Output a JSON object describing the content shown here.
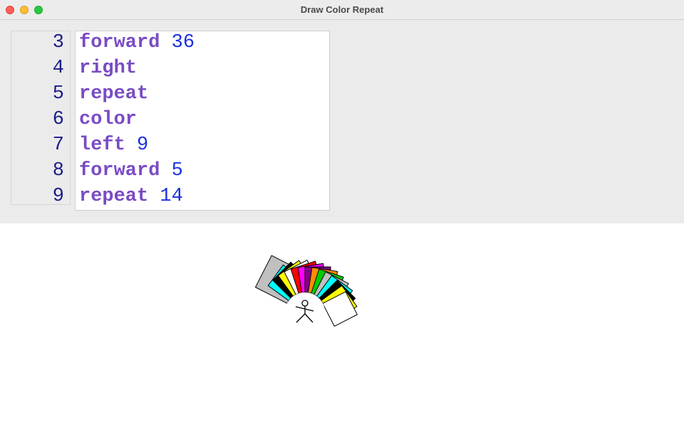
{
  "window": {
    "title": "Draw Color Repeat"
  },
  "editor": {
    "lines": [
      {
        "number": "3",
        "keyword": "forward",
        "arg": "36"
      },
      {
        "number": "4",
        "keyword": "right",
        "arg": ""
      },
      {
        "number": "5",
        "keyword": "repeat",
        "arg": ""
      },
      {
        "number": "6",
        "keyword": "color",
        "arg": ""
      },
      {
        "number": "7",
        "keyword": "left",
        "arg": "9"
      },
      {
        "number": "8",
        "keyword": "forward",
        "arg": "5"
      },
      {
        "number": "9",
        "keyword": "repeat",
        "arg": "14"
      }
    ],
    "colors": {
      "keyword": "#7a4bc4",
      "number": "#1a2fe0",
      "line_number": "#1c1c8a"
    }
  },
  "drawing": {
    "square_fill_colors": [
      "#c0c0c0",
      "#00ffff",
      "#000000",
      "#ffff00",
      "#ffffff",
      "#ff0000",
      "#ff00ff",
      "#800080",
      "#ff8c00",
      "#00cc00",
      "#c0c0c0",
      "#00ffff",
      "#000000",
      "#ffff00",
      "#ffffff"
    ],
    "turtle": "stick-figure"
  }
}
